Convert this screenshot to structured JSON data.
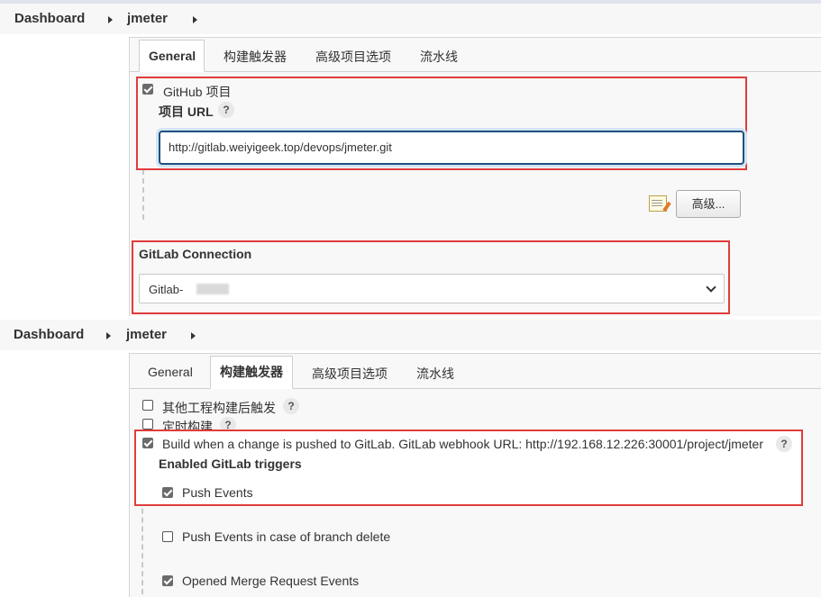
{
  "top": {
    "breadcrumb": {
      "dashboard": "Dashboard",
      "project": "jmeter"
    },
    "tabs": [
      "General",
      "构建触发器",
      "高级项目选项",
      "流水线"
    ],
    "github_project": {
      "checkbox_label": "GitHub 项目",
      "checked": true
    },
    "project_url": {
      "label": "项目 URL",
      "help": "?",
      "value": "http://gitlab.weiyigeek.top/devops/jmeter.git"
    },
    "advanced_button": "高级...",
    "edit_icon": "notepad-pencil-icon",
    "gitlab_connection": {
      "label": "GitLab Connection",
      "selected": "Gitlab-"
    }
  },
  "bottom": {
    "breadcrumb": {
      "dashboard": "Dashboard",
      "project": "jmeter"
    },
    "tabs": [
      "General",
      "构建触发器",
      "高级项目选项",
      "流水线"
    ],
    "triggers": [
      {
        "label": "其他工程构建后触发",
        "checked": false,
        "help": "?"
      },
      {
        "label": "定时构建",
        "checked": false,
        "help": "?"
      },
      {
        "label": "Build when a change is pushed to GitLab. GitLab webhook URL: http://192.168.12.226:30001/project/jmeter",
        "checked": true,
        "help": "?"
      }
    ],
    "enabled_triggers_heading": "Enabled GitLab triggers",
    "events": [
      {
        "label": "Push Events",
        "checked": true
      },
      {
        "label": "Push Events in case of branch delete",
        "checked": false
      },
      {
        "label": "Opened Merge Request Events",
        "checked": true
      }
    ]
  },
  "colors": {
    "highlight_border": "#e03c3c",
    "input_focus_border": "#1e4f80"
  }
}
